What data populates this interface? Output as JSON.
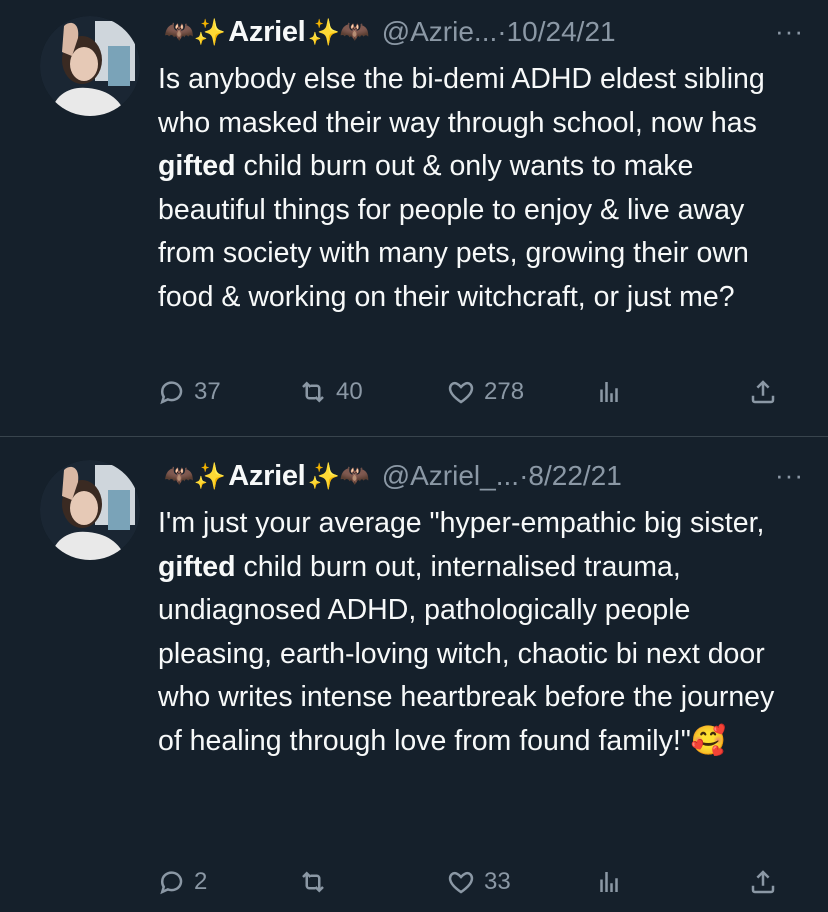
{
  "tweets": [
    {
      "name": "Azriel",
      "handle": "@Azrie...",
      "separator": "·",
      "date": "10/24/21",
      "more": "···",
      "text_before": "Is anybody else the bi-demi ADHD eldest sibling who masked their way through school, now has ",
      "text_bold": "gifted",
      "text_after": " child burn out & only wants to make beautiful things for people to enjoy & live away from society with many pets, growing their own food & working on their witchcraft, or just me?",
      "replies": "37",
      "retweets": "40",
      "likes": "278"
    },
    {
      "name": "Azriel",
      "handle": "@Azriel_...",
      "separator": "·",
      "date": "8/22/21",
      "more": "···",
      "text_before": "I'm just your average \"hyper-empathic big sister, ",
      "text_bold": "gifted",
      "text_after": " child burn out, internalised trauma, undiagnosed ADHD, pathologically people pleasing, earth-loving witch, chaotic bi next door who writes intense heartbreak before the journey of healing through love from found family!\"🥰",
      "replies": "2",
      "retweets": "",
      "likes": "33"
    }
  ],
  "icons": {
    "bat": "🦇",
    "sparkles": "✨",
    "reply": "reply-icon",
    "retweet": "retweet-icon",
    "like": "like-icon",
    "views": "views-icon",
    "share": "share-icon"
  }
}
